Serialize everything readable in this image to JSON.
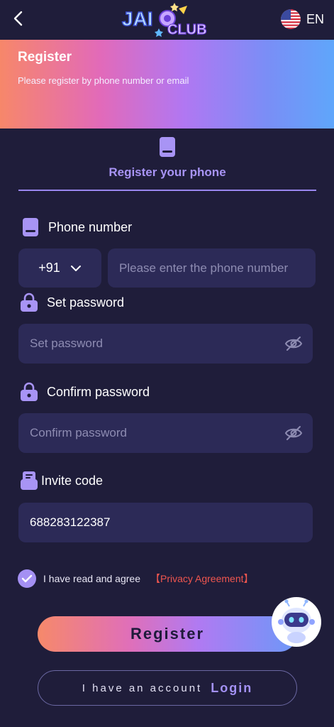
{
  "header": {
    "logo_text_left": "JAI",
    "logo_text_right": "CLUB",
    "language": "EN"
  },
  "banner": {
    "title": "Register",
    "subtitle": "Please register by phone number or email"
  },
  "tab": {
    "label": "Register your phone"
  },
  "form": {
    "phone_label": "Phone number",
    "country_code": "+91",
    "phone_placeholder": "Please enter the phone number",
    "password_label": "Set password",
    "password_placeholder": "Set password",
    "confirm_label": "Confirm password",
    "confirm_placeholder": "Confirm password",
    "invite_label": "Invite code",
    "invite_value": "688283122387"
  },
  "agreement": {
    "text": "I have read and agree",
    "link": "【Privacy Agreement】",
    "checked": true
  },
  "buttons": {
    "register": "Register",
    "have_account": "I have an account",
    "login": "Login"
  },
  "colors": {
    "background": "#1f1d3a",
    "input_bg": "#2c2a57",
    "accent": "#a894f5",
    "link_red": "#f0564f"
  },
  "icons": {
    "back": "chevron-left-icon",
    "flag": "us-flag-icon",
    "phone": "phone-icon",
    "lock": "lock-icon",
    "invite": "invite-icon",
    "eye_off": "eye-off-icon",
    "check": "check-icon",
    "robot": "robot-assistant-icon"
  }
}
